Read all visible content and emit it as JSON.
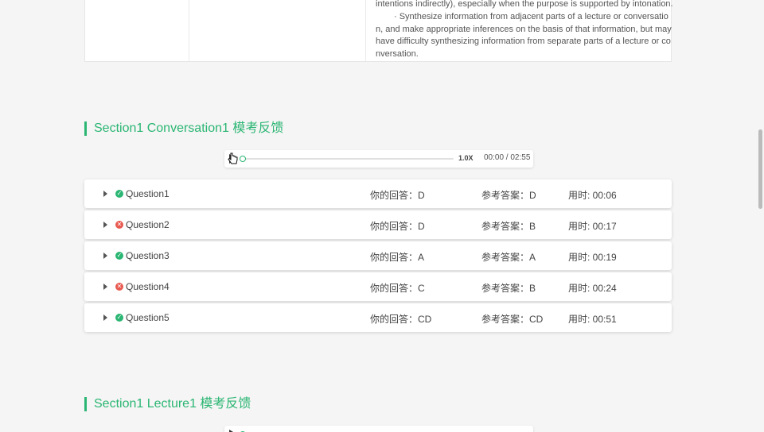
{
  "description_table": {
    "lines": [
      "intentions indirectly), especially when the purpose is supported by intonation.",
      "· Synthesize information from adjacent parts of a lecture or conversatio",
      "n, and make appropriate inferences on the basis of that information, but may",
      "have difficulty synthesizing information from separate parts of a lecture or co",
      "nversation."
    ]
  },
  "section1": {
    "title": "Section1 Conversation1 模考反馈",
    "player": {
      "speed": "1.0X",
      "time": "00:00 / 02:55",
      "progress": 0
    },
    "questions": [
      {
        "name": "Question1",
        "answer": "你的回答：D",
        "reference": "参考答案：D",
        "time": "用时: 00:06",
        "correct": true
      },
      {
        "name": "Question2",
        "answer": "你的回答：D",
        "reference": "参考答案：B",
        "time": "用时: 00:17",
        "correct": false
      },
      {
        "name": "Question3",
        "answer": "你的回答：A",
        "reference": "参考答案：A",
        "time": "用时: 00:19",
        "correct": true
      },
      {
        "name": "Question4",
        "answer": "你的回答：C",
        "reference": "参考答案：B",
        "time": "用时: 00:24",
        "correct": false
      },
      {
        "name": "Question5",
        "answer": "你的回答：CD",
        "reference": "参考答案：CD",
        "time": "用时: 00:51",
        "correct": true
      }
    ]
  },
  "section2": {
    "title": "Section1 Lecture1 模考反馈"
  },
  "colors": {
    "accent": "#2bb673",
    "error": "#e8594f"
  },
  "icons": {
    "correct": "check-circle-icon",
    "wrong": "x-circle-icon",
    "expand": "caret-right-icon",
    "play": "play-icon"
  }
}
